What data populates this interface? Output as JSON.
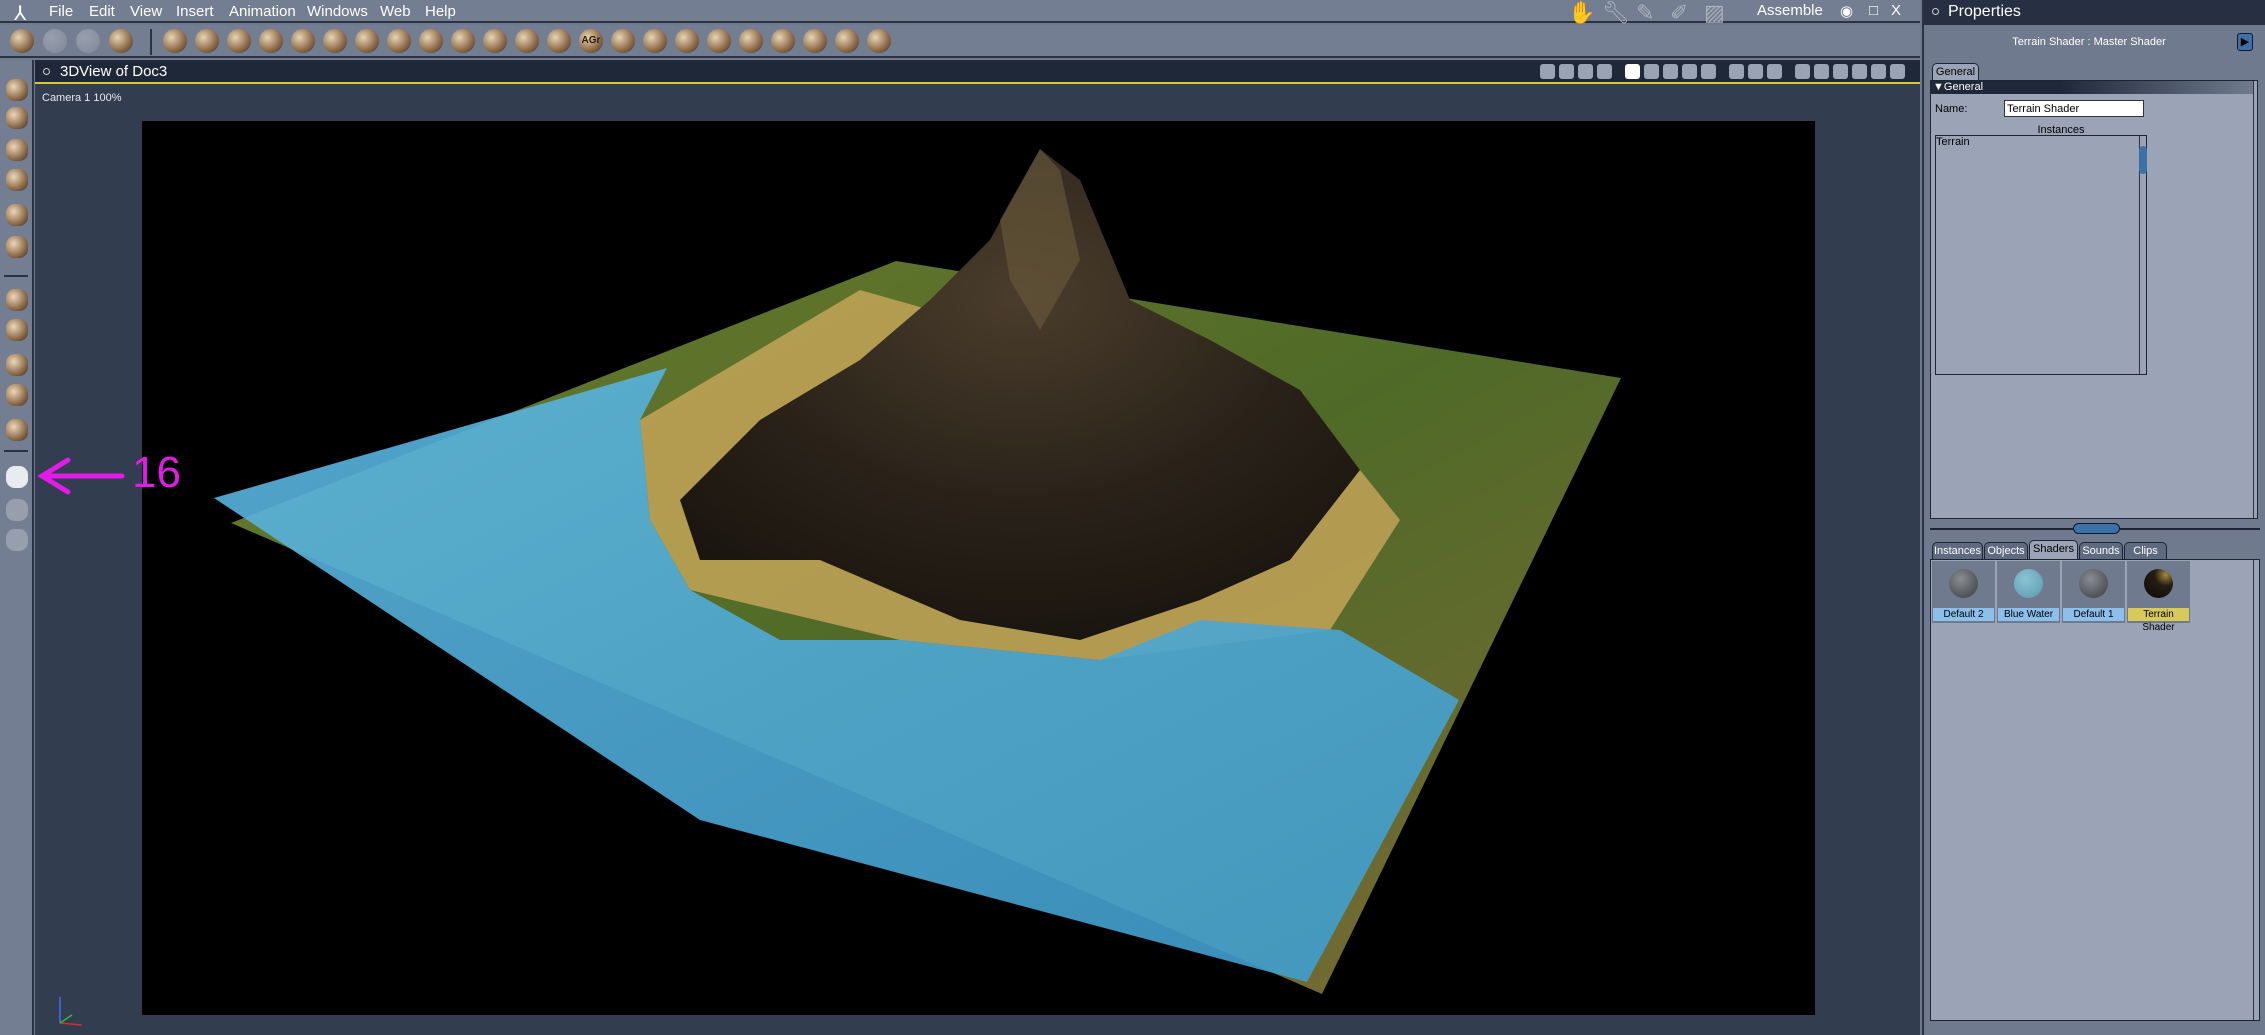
{
  "menubar": {
    "items": [
      "File",
      "Edit",
      "View",
      "Insert",
      "Animation",
      "Windows",
      "Web",
      "Help"
    ]
  },
  "toolbar": {
    "left_icons": [
      "brush-icon",
      "hand-icon",
      "wrench-icon",
      "paint-bucket-icon"
    ],
    "insert_icons": [
      "floor-icon",
      "goblet-icon",
      "sphere-icon",
      "bone-icon",
      "ring-icon",
      "text-icon",
      "particles-icon",
      "terrain-icon",
      "tree-icon",
      "cloud-icon",
      "fire-icon",
      "boulders-icon",
      "grass-icon",
      "agr-icon",
      "house-icon",
      "cylinder-icon",
      "bowl-icon",
      "blob-icon",
      "light-icon",
      "camera-icon",
      "nodes-icon",
      "target-icon",
      "wand-icon"
    ],
    "agr_text": "AGr",
    "mode_icons": [
      "hand-icon",
      "wrench-icon",
      "pen-icon",
      "brush-icon",
      "film-icon"
    ],
    "room": "Assemble"
  },
  "window_controls": [
    "eye-icon",
    "maximize-icon",
    "close-icon"
  ],
  "close_glyph": "X",
  "viewport": {
    "title": "3DView of Doc3",
    "camera_label": "Camera 1 100%",
    "toolbar_icons": [
      "scene-icon",
      "hierarchy-icon",
      "group-icon",
      "grid-icon",
      "single-view-icon",
      "split-view-icon",
      "quad-h-icon",
      "quad-view-icon",
      "l-view-icon",
      "wire-shield-icon",
      "shade-shield-icon",
      "texture-shield-icon",
      "up-arrow-icon",
      "bounding-icon",
      "wire-box-icon",
      "solid-box-icon",
      "smooth-sphere-icon",
      "textured-sphere-icon"
    ]
  },
  "left_toolbar": {
    "group1": [
      "select-arrow-icon",
      "move-icon",
      "rotate-icon",
      "scale-icon",
      "magic-wand-icon",
      "link-icon"
    ],
    "group2": [
      "pan-icon",
      "track-icon",
      "dolly-icon",
      "orbit-icon",
      "cube-view-icon"
    ],
    "group3": [
      "camera-icon",
      "hand-icon",
      "zoom-icon"
    ]
  },
  "annotation": {
    "label": "16",
    "color": "#e21be8"
  },
  "properties": {
    "title": "Properties",
    "header": "Terrain Shader : Master Shader",
    "tab": "General",
    "section": "General",
    "name_label": "Name:",
    "name_value": "Terrain Shader",
    "instances_label": "Instances",
    "instances": [
      "Terrain"
    ]
  },
  "library": {
    "tabs": [
      "Instances",
      "Objects",
      "Shaders",
      "Sounds",
      "Clips"
    ],
    "active_tab": "Shaders",
    "shaders": [
      {
        "name": "Default 2",
        "color": "#5c5f63",
        "selected": false
      },
      {
        "name": "Blue Water",
        "color": "#6fa9bd",
        "selected": false
      },
      {
        "name": "Default 1",
        "color": "#5c5f63",
        "selected": false
      },
      {
        "name": "Terrain Shader",
        "color": "#231d14",
        "selected": true
      }
    ]
  },
  "colors": {
    "accent_yellow": "#d8c832",
    "selection_blue": "#8cbfea",
    "selected_shader": "#d7c95a"
  }
}
